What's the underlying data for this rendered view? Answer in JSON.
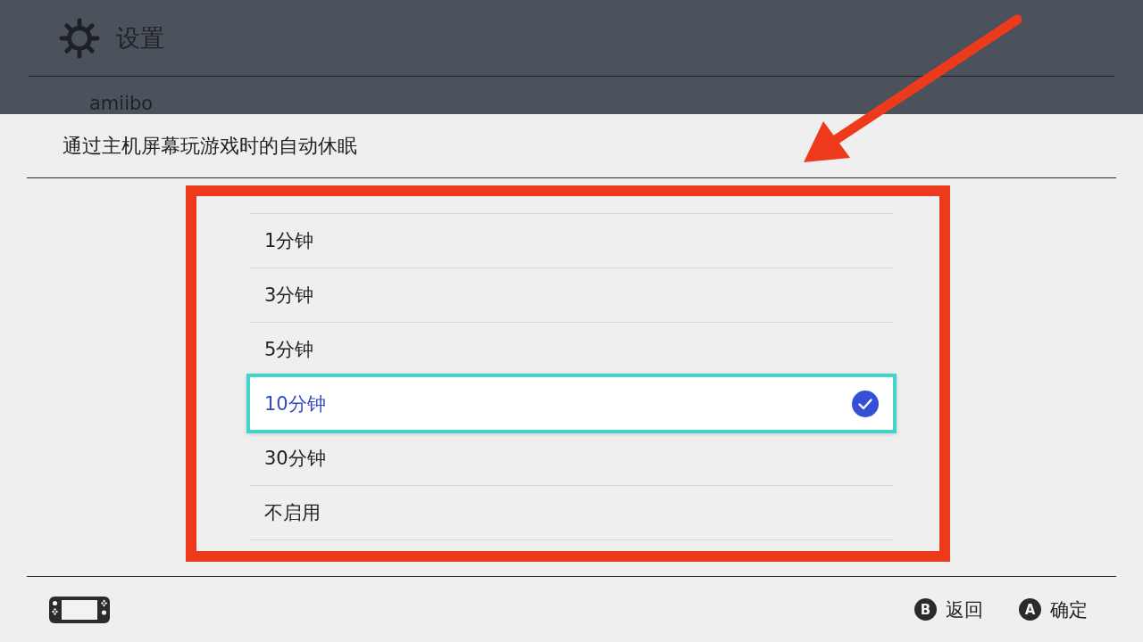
{
  "background": {
    "title": "设置",
    "items": [
      {
        "label": "amiibo"
      }
    ]
  },
  "dialog": {
    "title": "通过主机屏幕玩游戏时的自动休眠",
    "options": [
      {
        "label": "1分钟",
        "selected": false
      },
      {
        "label": "3分钟",
        "selected": false
      },
      {
        "label": "5分钟",
        "selected": false
      },
      {
        "label": "10分钟",
        "selected": true
      },
      {
        "label": "30分钟",
        "selected": false
      },
      {
        "label": "不启用",
        "selected": false
      }
    ]
  },
  "footer": {
    "actions": [
      {
        "key": "B",
        "label": "返回"
      },
      {
        "key": "A",
        "label": "确定"
      }
    ]
  }
}
